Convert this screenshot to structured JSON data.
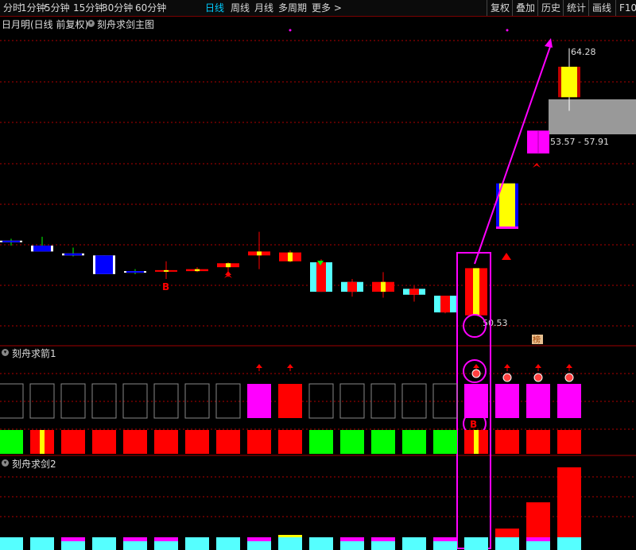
{
  "toolbar": {
    "periods": [
      "分时",
      "1分钟",
      "5分钟",
      "15分钟",
      "30分钟",
      "60分钟",
      "日线",
      "周线",
      "月线",
      "多周期",
      "更多 >"
    ],
    "active": "日线",
    "right": [
      "复权",
      "叠加",
      "历史",
      "统计",
      "画线",
      "F10"
    ]
  },
  "chart": {
    "title": "日月明(日线 前复权)",
    "indicator": "刻舟求剑主图",
    "labels": {
      "high": "64.28",
      "range": "53.57 - 57.91",
      "low": "50.53",
      "buy": "B",
      "tag": "榜"
    }
  },
  "panels": {
    "p1": "刻舟求箭1",
    "p2": "刻舟求剑2"
  },
  "colors": {
    "up": "#ff0000",
    "down": "#00ff00",
    "cyan": "#55ffff",
    "magenta": "#ff00ff",
    "blue": "#0000ff",
    "yellow": "#ffff00",
    "grid": "#b00000"
  },
  "chart_data": {
    "type": "candlestick",
    "series": [
      {
        "o": 44.6,
        "h": 44.9,
        "l": 44.2,
        "c": 44.7,
        "style": "blue"
      },
      {
        "o": 44.2,
        "h": 45.1,
        "l": 43.6,
        "c": 43.6,
        "style": "blue"
      },
      {
        "o": 43.4,
        "h": 44.0,
        "l": 43.1,
        "c": 43.2,
        "style": "blue"
      },
      {
        "o": 43.2,
        "h": 43.2,
        "l": 41.4,
        "c": 41.3,
        "style": "blue"
      },
      {
        "o": 41.6,
        "h": 41.8,
        "l": 41.3,
        "c": 41.6,
        "style": "blue"
      },
      {
        "o": 41.7,
        "h": 42.6,
        "l": 40.8,
        "c": 41.6,
        "style": "red"
      },
      {
        "o": 41.8,
        "h": 42.0,
        "l": 41.5,
        "c": 41.6,
        "style": "red"
      },
      {
        "o": 42.0,
        "h": 42.5,
        "l": 41.0,
        "c": 42.4,
        "style": "red"
      },
      {
        "o": 43.2,
        "h": 45.6,
        "l": 41.8,
        "c": 43.6,
        "style": "red"
      },
      {
        "o": 42.6,
        "h": 43.7,
        "l": 42.5,
        "c": 43.5,
        "style": "red"
      },
      {
        "o": 42.5,
        "h": 42.8,
        "l": 39.5,
        "c": 39.5,
        "style": "cyan"
      },
      {
        "o": 40.5,
        "h": 40.8,
        "l": 39.0,
        "c": 39.5,
        "style": "cyan"
      },
      {
        "o": 40.5,
        "h": 41.5,
        "l": 38.9,
        "c": 39.5,
        "style": "red"
      },
      {
        "o": 39.8,
        "h": 40.1,
        "l": 38.5,
        "c": 39.2,
        "style": "cyan"
      },
      {
        "o": 39.1,
        "h": 39.1,
        "l": 37.3,
        "c": 37.4,
        "style": "cyan"
      },
      {
        "o": 41.9,
        "h": 41.9,
        "l": 37.1,
        "c": 37.1,
        "style": "redbig"
      },
      {
        "o": 45.9,
        "h": 45.9,
        "l": 50.53,
        "c": 50.53,
        "style": "blueyellow"
      },
      {
        "o": 53.57,
        "h": 55.9,
        "l": 53.57,
        "c": 55.9,
        "style": "magenta"
      },
      {
        "o": 59.3,
        "h": 64.28,
        "l": 57.91,
        "c": 62.4,
        "style": "yellowred"
      }
    ],
    "panel1": {
      "top": [
        "empty",
        "empty",
        "empty",
        "empty",
        "empty",
        "empty",
        "empty",
        "empty",
        "magenta",
        "red",
        "empty",
        "empty",
        "empty",
        "empty",
        "empty",
        "magenta",
        "magenta",
        "magenta",
        "magenta"
      ],
      "bottom": [
        "green",
        "redyellow",
        "red",
        "red",
        "red",
        "red",
        "red",
        "red",
        "red",
        "red",
        "green",
        "green",
        "green",
        "green",
        "green",
        "redyellow",
        "red",
        "red",
        "red"
      ]
    },
    "panel2": {
      "values": [
        0,
        0,
        0,
        0,
        0,
        0,
        0,
        0,
        0,
        0,
        0,
        0,
        0,
        0,
        0,
        0,
        1,
        4,
        8
      ]
    }
  }
}
